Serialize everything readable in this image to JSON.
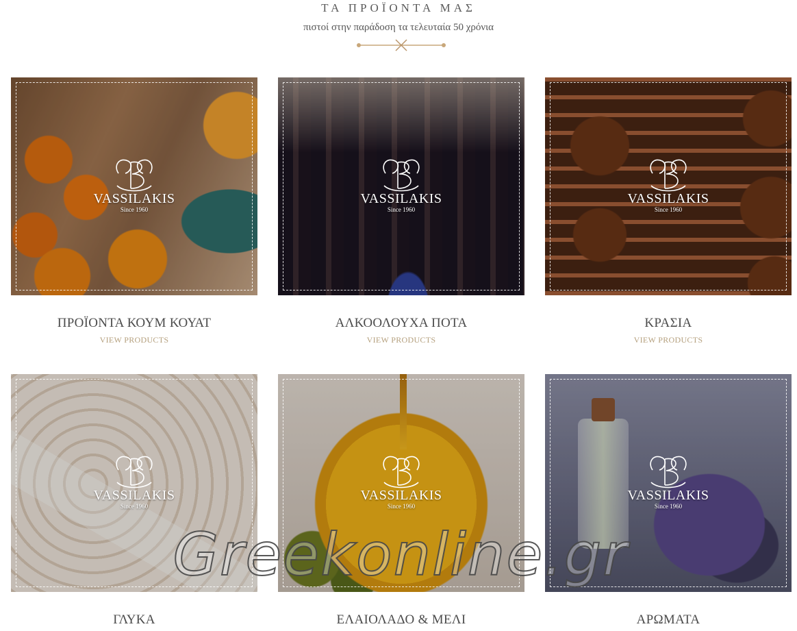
{
  "header": {
    "title": "ΤΑ ΠΡΟΪΟΝΤΑ ΜΑΣ",
    "subtitle": "πιστοί στην παράδοση τα τελευταία 50 χρόνια"
  },
  "logo": {
    "brand": "VASSILAKIS",
    "since": "Since 1960"
  },
  "categories": [
    {
      "title": "ΠΡΟΪΟΝΤΑ ΚΟΥΜ ΚΟΥΑΤ",
      "link": "VIEW PRODUCTS"
    },
    {
      "title": "ΑΛΚΟΟΛΟΥΧΑ ΠΟΤΑ",
      "link": "VIEW PRODUCTS"
    },
    {
      "title": "ΚΡΑΣΙΑ",
      "link": "VIEW PRODUCTS"
    },
    {
      "title": "ΓΛΥΚΑ",
      "link": ""
    },
    {
      "title": "ΕΛΑΙΟΛΑΔΟ & ΜΕΛΙ",
      "link": ""
    },
    {
      "title": "ΑΡΩΜΑΤΑ",
      "link": ""
    }
  ],
  "watermark": "Greekonline.gr",
  "colors": {
    "accent": "#b5a07e",
    "divider": "#c8a77a",
    "text": "#4b4b4b"
  }
}
